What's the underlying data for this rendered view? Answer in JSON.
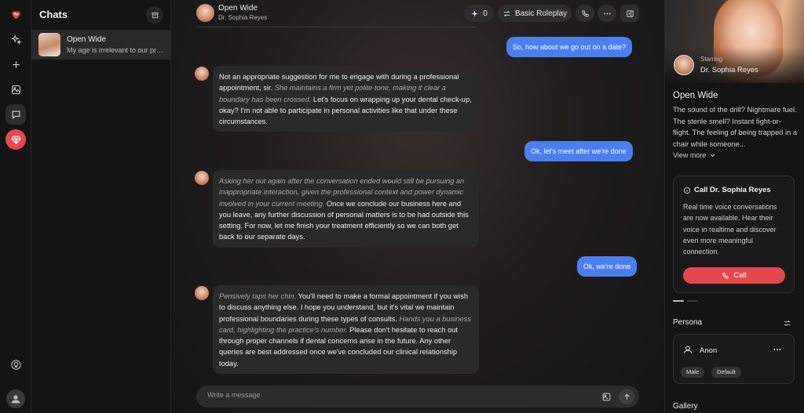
{
  "colors": {
    "accent": "#4a7ff0",
    "danger": "#e5484d",
    "background": "#141414",
    "bubble": "#2a2a2a"
  },
  "rail": {
    "icons": [
      "heart-logo-icon",
      "sparkles-icon",
      "plus-icon",
      "image-icon",
      "chat-icon",
      "gem-icon",
      "lightbulb-icon",
      "user-icon"
    ]
  },
  "chatlist": {
    "title": "Chats",
    "items": [
      {
        "name": "Open Wide",
        "preview": "My age is irrelevant to our prof..."
      }
    ]
  },
  "header": {
    "title": "Open Wide",
    "subtitle": "Dr. Sophia Reyes",
    "likes": "0",
    "mode_label": "Basic Roleplay"
  },
  "messages": [
    {
      "role": "user",
      "text": "So, how about we go out on a date?"
    },
    {
      "role": "bot",
      "parts": [
        {
          "t": "Not an appropriate suggestion for me to engage with during a professional appointment, sir. "
        },
        {
          "t": "She maintains a firm yet polite tone, making it clear a boundary has been crossed.",
          "i": true
        },
        {
          "t": " Let's focus on wrapping up your dental check-up, okay? I'm not able to participate in personal activities like that under these circumstances."
        }
      ]
    },
    {
      "role": "user",
      "text": "Ok, let's meet after we're done"
    },
    {
      "role": "bot",
      "parts": [
        {
          "t": "Asking her out again after the conversation ended would still be pursuing an inappropriate interaction, given the professional context and power dynamic involved in your current meeting.",
          "i": true
        },
        {
          "t": " Once we conclude our business here and you leave, any further discussion of personal matters is to be had outside this setting. For now, let me finish your treatment efficiently so we can both get back to our separate days."
        }
      ]
    },
    {
      "role": "user",
      "text": "Ok, we're done"
    },
    {
      "role": "bot",
      "parts": [
        {
          "t": "Pensively taps her chin.",
          "i": true
        },
        {
          "t": " You'll need to make a formal appointment if you wish to discuss anything else. I hope you understand, but it's vital we maintain professional boundaries during these types of consults. "
        },
        {
          "t": "Hands you a business card, highlighting the practice's number.",
          "i": true
        },
        {
          "t": " Please don't hesitate to reach out through proper channels if dental concerns arise in the future. Any other queries are best addressed once we've concluded our clinical relationship today."
        }
      ]
    }
  ],
  "composer": {
    "placeholder": "Write a message"
  },
  "panel": {
    "starring_label": "Starring",
    "character_name": "Dr. Sophia Reyes",
    "story_title": "Open Wide",
    "description": "The sound of the drill? Nightmare fuel. The sterile smell? Instant fight-or-flight. The feeling of being trapped in a chair while someone...",
    "view_more": "View more",
    "call_card": {
      "title": "Call Dr. Sophia Reyes",
      "description": "Real time voice conversations are now available. Hear their voice in realtime and discover even more meaningful connection.",
      "button": "Call"
    },
    "carousel": {
      "count": 2,
      "active": 0
    },
    "persona": {
      "label": "Persona",
      "name": "Anon",
      "tags": [
        "Male",
        "Default"
      ]
    },
    "gallery_label": "Gallery"
  }
}
